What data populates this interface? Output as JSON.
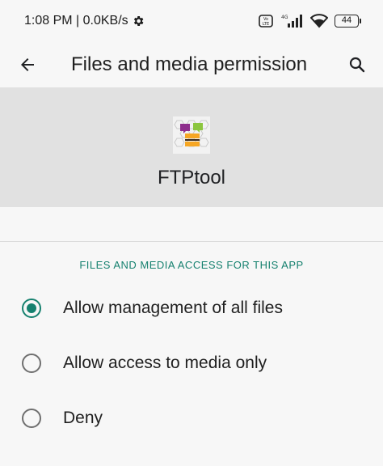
{
  "status_bar": {
    "time": "1:08 PM",
    "speed": "0.0KB/s",
    "battery_level": "44",
    "network_label": "4G"
  },
  "app_bar": {
    "title": "Files and media permission"
  },
  "app": {
    "name": "FTPtool"
  },
  "section": {
    "header": "FILES AND MEDIA ACCESS FOR THIS APP"
  },
  "options": [
    {
      "label": "Allow management of all files",
      "selected": true
    },
    {
      "label": "Allow access to media only",
      "selected": false
    },
    {
      "label": "Deny",
      "selected": false
    }
  ],
  "colors": {
    "accent": "#16816f",
    "header_bg": "#e1e1e1",
    "page_bg": "#f7f7f7"
  }
}
